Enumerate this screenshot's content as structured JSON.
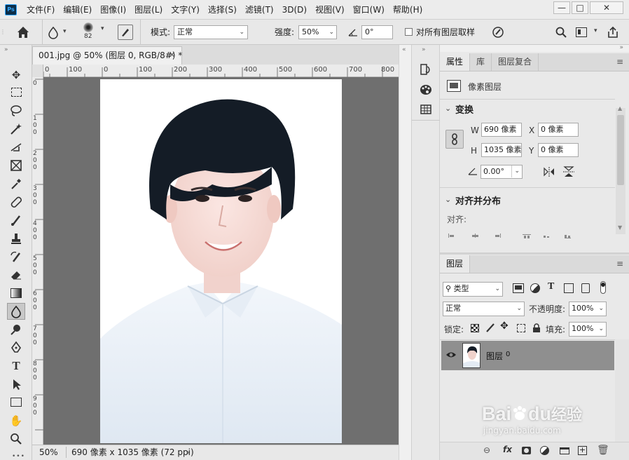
{
  "menu": {
    "logo": "Ps",
    "items": [
      "文件(F)",
      "编辑(E)",
      "图像(I)",
      "图层(L)",
      "文字(Y)",
      "选择(S)",
      "滤镜(T)",
      "3D(D)",
      "视图(V)",
      "窗口(W)",
      "帮助(H)"
    ],
    "minimize": "—",
    "maximize": "□",
    "close": "✕"
  },
  "options": {
    "brush_size": "82",
    "mode_label": "模式:",
    "mode_value": "正常",
    "strength_label": "强度:",
    "strength_value": "50%",
    "angle_value": "0°",
    "sample_all_layers": "对所有图层取样"
  },
  "document": {
    "tab_title": "001.jpg @ 50% (图层 0, RGB/8#) *",
    "tab_close": "×",
    "zoom": "50%",
    "info": "690 像素 x 1035 像素 (72 ppi)",
    "ruler_h": [
      "0",
      "100",
      "0",
      "100",
      "200",
      "300",
      "400",
      "500",
      "600",
      "700",
      "800"
    ],
    "ruler_v": [
      "0",
      "1 0 0",
      "2 0 0",
      "3 0 0",
      "4 0 0",
      "5 0 0",
      "6 0 0",
      "7 0 0",
      "8 0 0",
      "9 0 0"
    ]
  },
  "properties": {
    "tabs": [
      "属性",
      "库",
      "图层复合"
    ],
    "layer_type": "像素图层",
    "transform_title": "变换",
    "w_label": "W",
    "w_value": "690 像素",
    "h_label": "H",
    "h_value": "1035 像素",
    "x_label": "X",
    "x_value": "0 像素",
    "y_label": "Y",
    "y_value": "0 像素",
    "angle_value": "0.00°",
    "align_title": "对齐并分布",
    "align_label": "对齐:"
  },
  "layers": {
    "tab": "图层",
    "filter_kind": "类型",
    "blend_mode": "正常",
    "opacity_label": "不透明度:",
    "opacity_value": "100%",
    "lock_label": "锁定:",
    "fill_label": "填充:",
    "fill_value": "100%",
    "items": [
      {
        "name": "图层",
        "index": "0"
      }
    ]
  },
  "watermark": {
    "brand": "Bai",
    "brand2": "du",
    "suffix": "经验",
    "url": "jingyan.baidu.com"
  },
  "colors": {
    "accent": "#31a8ff",
    "panel": "#e9e9e9",
    "canvas_bg": "#6f6f6f",
    "selected_layer": "#8f8f8f"
  }
}
